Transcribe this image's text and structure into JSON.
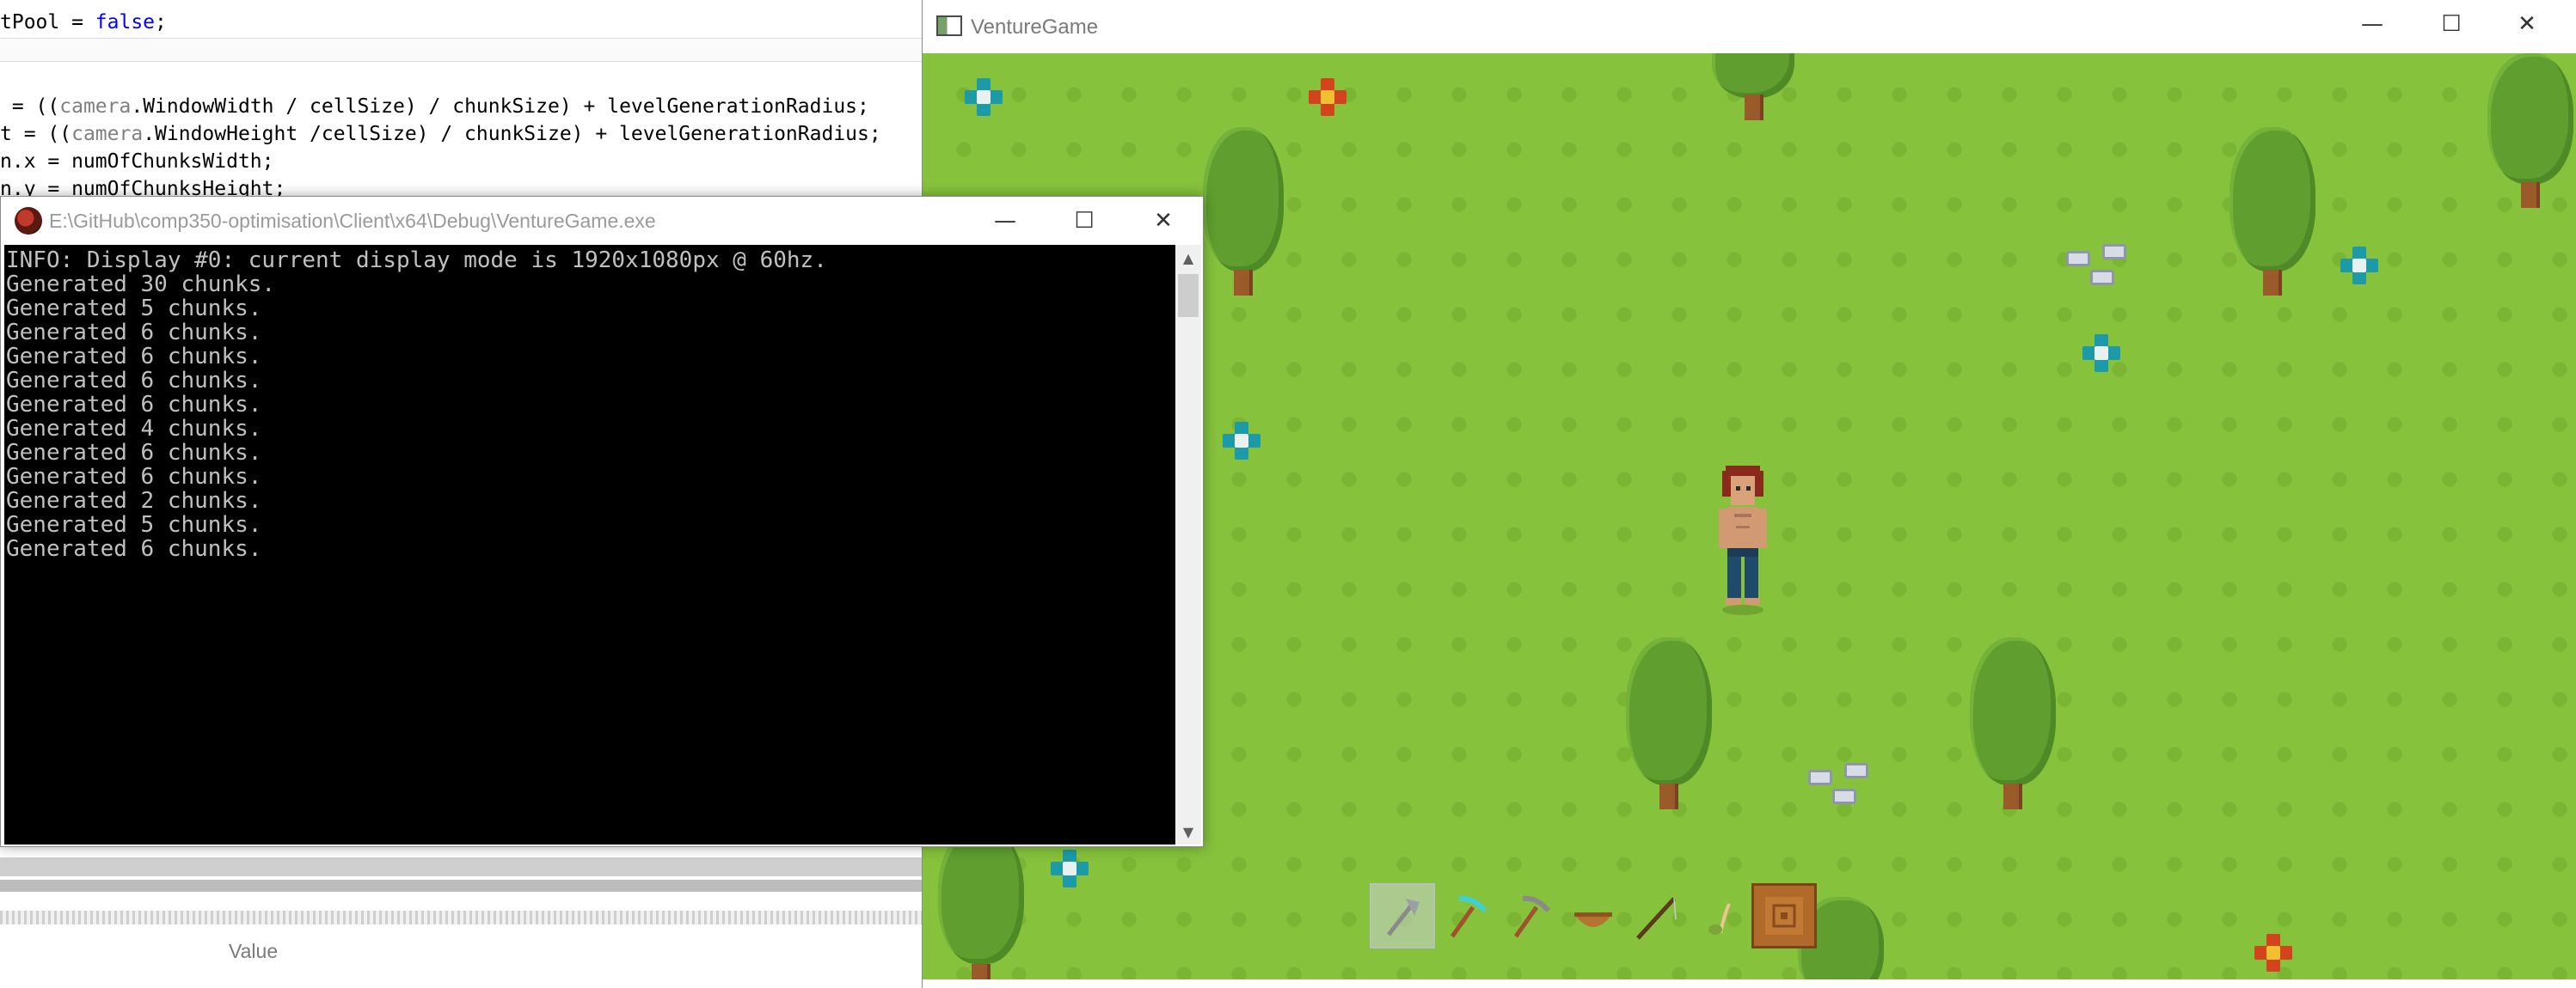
{
  "editor": {
    "lines": [
      {
        "parts": [
          {
            "t": "tPool = "
          },
          {
            "t": "false",
            "c": "kw"
          },
          {
            "t": ";"
          }
        ]
      },
      {
        "parts": [
          {
            "t": " = (("
          },
          {
            "t": "camera",
            "c": "obj"
          },
          {
            "t": ".WindowWidth / cellSize) / chunkSize) + levelGenerationRadius;"
          }
        ]
      },
      {
        "parts": [
          {
            "t": "t = (("
          },
          {
            "t": "camera",
            "c": "obj"
          },
          {
            "t": ".WindowHeight /cellSize) / chunkSize) + levelGenerationRadius;"
          }
        ]
      },
      {
        "parts": [
          {
            "t": "n.x = numOfChunksWidth;"
          }
        ]
      },
      {
        "parts": [
          {
            "t": "n.y = numOfChunksHeight;"
          }
        ]
      }
    ],
    "value_header": "Value"
  },
  "console": {
    "title": "E:\\GitHub\\comp350-optimisation\\Client\\x64\\Debug\\VentureGame.exe",
    "lines": [
      "INFO: Display #0: current display mode is 1920x1080px @ 60hz.",
      "Generated 30 chunks.",
      "Generated 5 chunks.",
      "Generated 6 chunks.",
      "Generated 6 chunks.",
      "Generated 6 chunks.",
      "Generated 6 chunks.",
      "Generated 4 chunks.",
      "Generated 6 chunks.",
      "Generated 6 chunks.",
      "Generated 2 chunks.",
      "Generated 5 chunks.",
      "Generated 6 chunks."
    ],
    "buttons": {
      "minimize": "—",
      "maximize": "☐",
      "close": "✕"
    }
  },
  "game": {
    "title": "VentureGame",
    "buttons": {
      "minimize": "—",
      "maximize": "☐",
      "close": "✕"
    },
    "hotbar": {
      "selected_index": 0,
      "items": [
        "axe-icon",
        "pickaxe-diamond-icon",
        "pickaxe-icon",
        "bowl-icon",
        "fishing-rod-icon",
        "seed-icon",
        "wood-log-icon"
      ]
    },
    "colors": {
      "grass": "#86c23c",
      "tree": "#5f9e2f",
      "trunk": "#9a5a2a",
      "flower_blue": "#1c9aa8",
      "flower_red": "#d4441c"
    }
  }
}
